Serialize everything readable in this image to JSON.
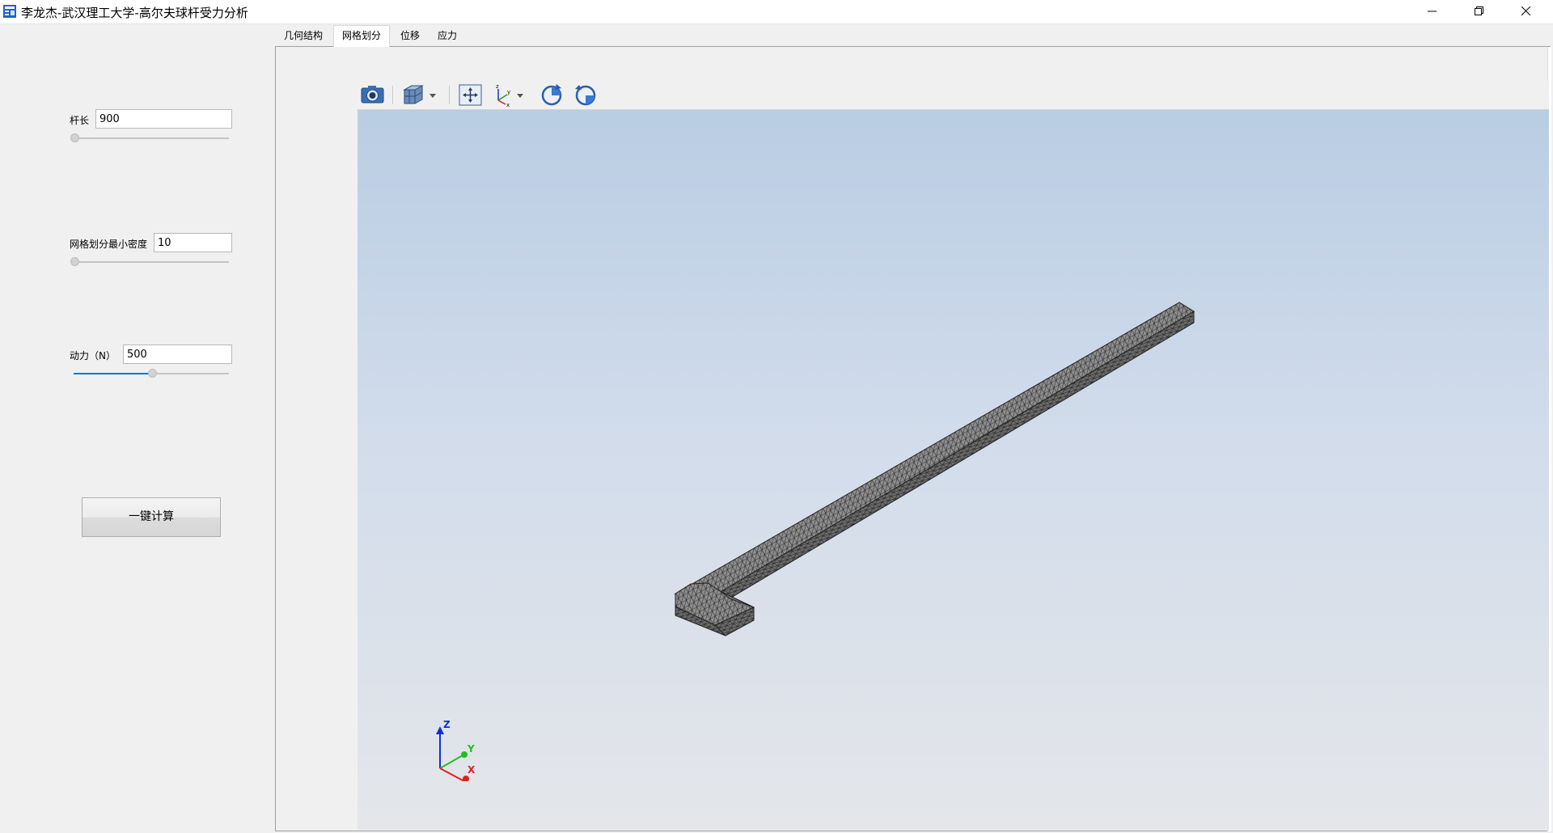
{
  "window": {
    "title": "李龙杰-武汉理工大学-高尔夫球杆受力分析",
    "icon": "app-window-icon"
  },
  "left_panel": {
    "rod_length": {
      "label": "杆长",
      "value": "900",
      "slider_level": 0.0
    },
    "mesh_density": {
      "label": "网格划分最小密度",
      "value": "10",
      "slider_level": 0.0
    },
    "force": {
      "label": "动力（N）",
      "value": "500",
      "slider_level": 0.5
    },
    "calc_button_label": "一键计算"
  },
  "tabs": [
    {
      "label": "几何结构",
      "active": false
    },
    {
      "label": "网格划分",
      "active": true
    },
    {
      "label": "位移",
      "active": false
    },
    {
      "label": "应力",
      "active": false
    }
  ],
  "viewer_toolbar": {
    "buttons": [
      "camera-icon",
      "view-cube-icon",
      "fit-all-icon",
      "axis-orientation-icon",
      "rotate-clockwise-icon",
      "rotate-counterclockwise-icon"
    ]
  },
  "axes_triad": {
    "x": "X",
    "y": "Y",
    "z": "Z"
  },
  "colors": {
    "accent": "#0078d7",
    "viewport_top": "#b9cde3",
    "viewport_bottom": "#e4e6ea",
    "mesh_fill": "#8c8c8c",
    "axis_x": "#e02020",
    "axis_y": "#20c020",
    "axis_z": "#1030d0"
  }
}
